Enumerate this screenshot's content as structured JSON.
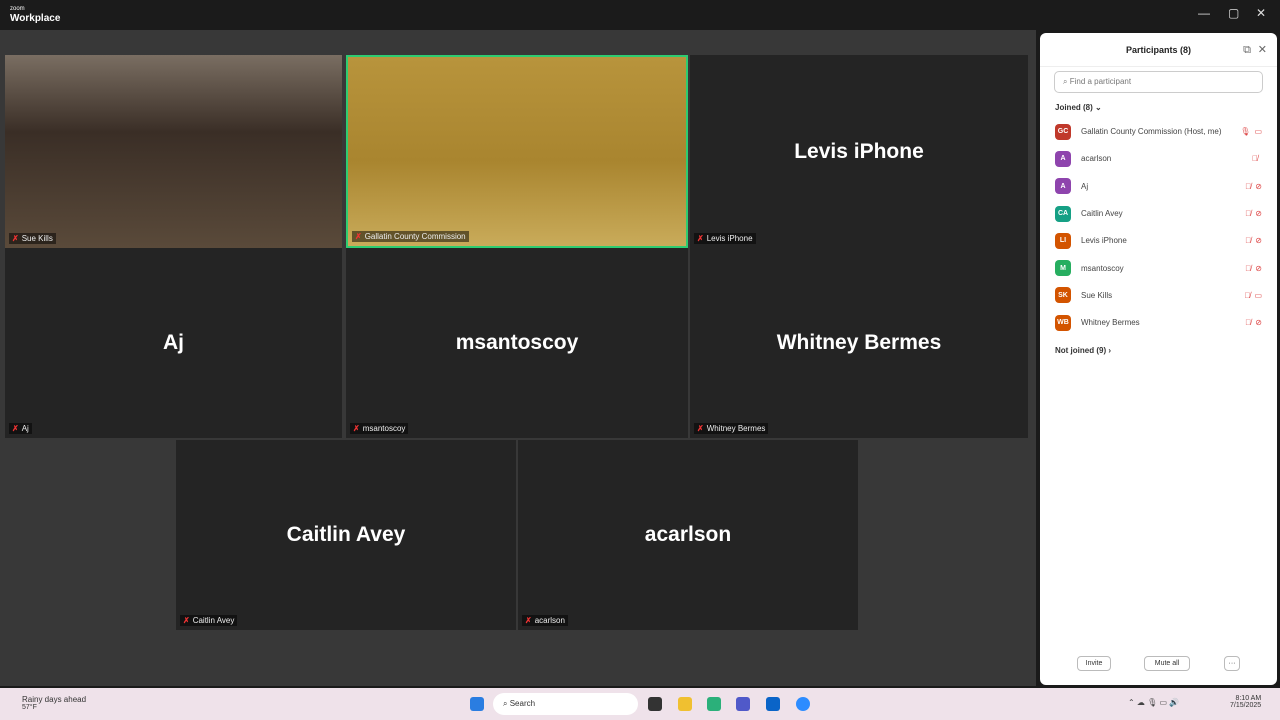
{
  "window": {
    "brand_small": "zoom",
    "brand": "Workplace",
    "minimize": "—",
    "restore": "▢",
    "close": "✕"
  },
  "tiles": [
    {
      "name": "Sue Kills",
      "label": "Sue Kills",
      "video": true
    },
    {
      "name": "Gallatin County Commission",
      "label": "Gallatin County Commission",
      "video": true,
      "active": true
    },
    {
      "name": "Levis iPhone",
      "label": "Levis iPhone"
    },
    {
      "name": "Aj",
      "label": "Aj"
    },
    {
      "name": "msantoscoy",
      "label": "msantoscoy"
    },
    {
      "name": "Whitney Bermes",
      "label": "Whitney Bermes"
    },
    {
      "name": "Caitlin Avey",
      "label": "Caitlin Avey"
    },
    {
      "name": "acarlson",
      "label": "acarlson"
    }
  ],
  "panel": {
    "title": "Participants (8)",
    "search_placeholder": "Find a participant",
    "joined": "Joined (8)",
    "not_joined": "Not joined (9)",
    "participants": [
      {
        "initials": "GC",
        "name": "Gallatin County Commission (Host, me)",
        "color": "#c0392b",
        "mic": "🎙",
        "cam": "▭"
      },
      {
        "initials": "A",
        "name": "acarlson",
        "color": "#8e44ad",
        "mic": "🎙̸",
        "cam": ""
      },
      {
        "initials": "A",
        "name": "Aj",
        "color": "#8e44ad",
        "mic": "🎙̸",
        "cam": "⊘"
      },
      {
        "initials": "CA",
        "name": "Caitlin Avey",
        "color": "#16a085",
        "mic": "🎙̸",
        "cam": "⊘"
      },
      {
        "initials": "LI",
        "name": "Levis iPhone",
        "color": "#d35400",
        "mic": "🎙̸",
        "cam": "⊘"
      },
      {
        "initials": "M",
        "name": "msantoscoy",
        "color": "#27ae60",
        "mic": "🎙̸",
        "cam": "⊘"
      },
      {
        "initials": "SK",
        "name": "Sue Kills",
        "color": "#d35400",
        "mic": "🎙̸",
        "cam": "▭"
      },
      {
        "initials": "WB",
        "name": "Whitney Bermes",
        "color": "#d35400",
        "mic": "🎙̸",
        "cam": "⊘"
      }
    ],
    "invite": "Invite",
    "mute_all": "Mute all",
    "more": "···"
  },
  "taskbar": {
    "weather": "Rainy days ahead",
    "temp": "57°F",
    "search": "Search",
    "time": "8:10 AM",
    "date": "7/15/2025"
  }
}
